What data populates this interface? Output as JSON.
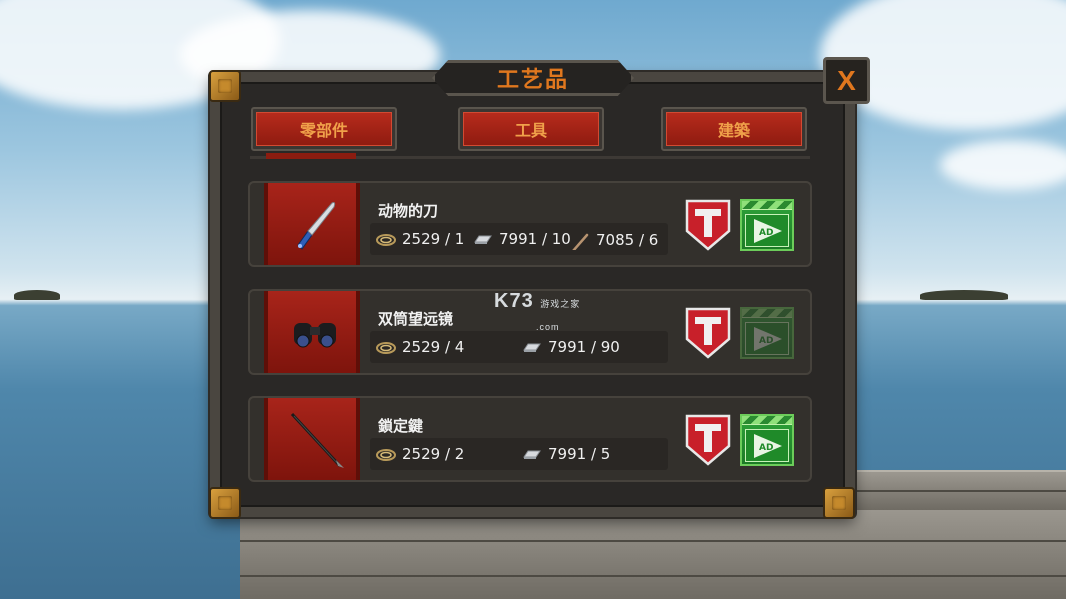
{
  "window": {
    "title": "工艺品",
    "close_label": "X"
  },
  "tabs": [
    {
      "label": "零部件"
    },
    {
      "label": "工具"
    },
    {
      "label": "建築"
    }
  ],
  "recipes": [
    {
      "name": "动物的刀",
      "icon": "knife-icon",
      "costs": [
        {
          "icon": "rope-icon",
          "text": "2529 / 1"
        },
        {
          "icon": "metal-bar-icon",
          "text": "7991 / 10"
        },
        {
          "icon": "stick-icon",
          "text": "7085 / 6"
        }
      ],
      "ad_enabled": true
    },
    {
      "name": "双筒望远镜",
      "icon": "binoculars-icon",
      "costs": [
        {
          "icon": "rope-icon",
          "text": "2529 / 4"
        },
        {
          "icon": "metal-bar-icon",
          "text": "7991 / 90"
        }
      ],
      "ad_enabled": false
    },
    {
      "name": "鎖定鍵",
      "icon": "spear-icon",
      "costs": [
        {
          "icon": "rope-icon",
          "text": "2529 / 2"
        },
        {
          "icon": "metal-bar-icon",
          "text": "7991 / 5"
        }
      ],
      "ad_enabled": true
    }
  ],
  "ad_label": "AD",
  "watermark": {
    "main": "K73",
    "sub": "游戏之家",
    "domain": ".com"
  },
  "colors": {
    "accent_orange": "#e0771e",
    "tab_red": "#b62b1c",
    "panel": "#2a2826",
    "ad_green": "#2fa43a"
  }
}
